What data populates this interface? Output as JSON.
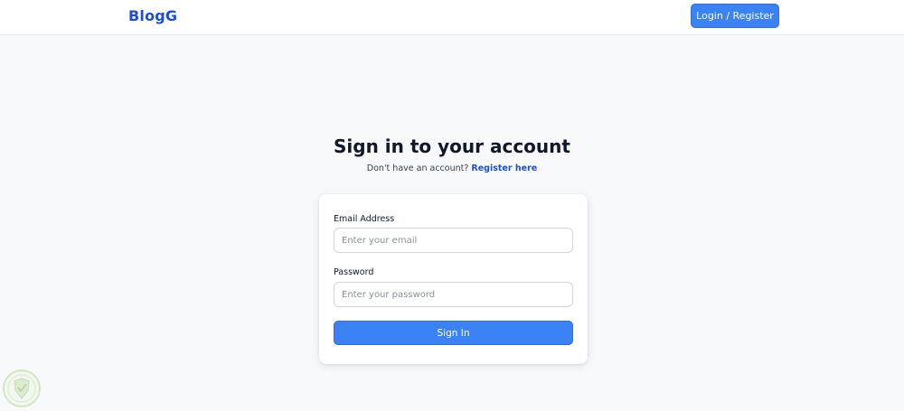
{
  "navbar": {
    "brand": "BlogG",
    "login_register_label": "Login / Register"
  },
  "signin": {
    "title": "Sign in to your account",
    "subtitle_prefix": "Don't have an account?",
    "register_link": "Register here"
  },
  "form": {
    "email_label": "Email Address",
    "email_placeholder": "Enter your email",
    "password_label": "Password",
    "password_placeholder": "Enter your password",
    "submit_label": "Sign In"
  },
  "colors": {
    "primary": "#3b82f6",
    "brand_text": "#1d4ed8",
    "page_background": "#f8f9fb"
  }
}
